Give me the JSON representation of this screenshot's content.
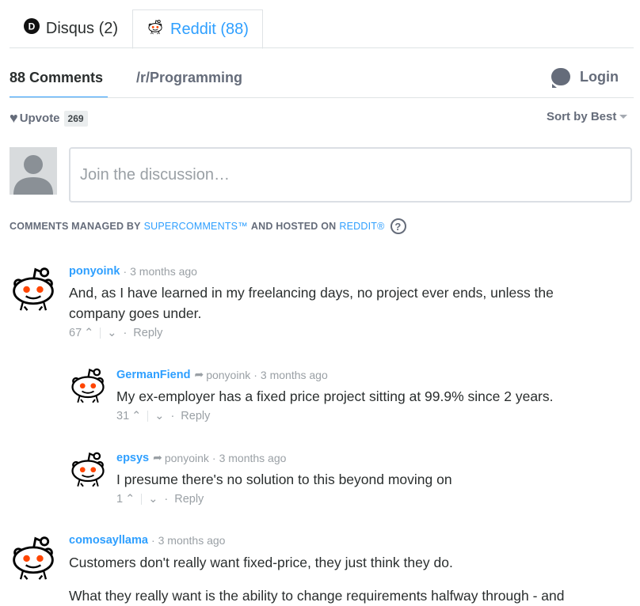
{
  "tabs": [
    {
      "label": "Disqus (2)",
      "icon": "disqus-logo-icon"
    },
    {
      "label": "Reddit (88)",
      "icon": "reddit-alien-icon",
      "active": true
    }
  ],
  "nav": {
    "comments_label": "88 Comments",
    "subreddit_label": "/r/Programming",
    "login_label": "Login"
  },
  "toolbar": {
    "upvote_label": "Upvote",
    "upvote_count": "269",
    "sort_label": "Sort by Best"
  },
  "composer": {
    "placeholder": "Join the discussion…"
  },
  "managed": {
    "prefix": "COMMENTS MANAGED BY",
    "supercomments": "SUPERCOMMENTS™",
    "middle": "AND HOSTED ON",
    "reddit": "REDDIT®",
    "help": "?"
  },
  "comments": [
    {
      "author": "ponyoink",
      "time": "3 months ago",
      "text_1": "And, as I have learned in my freelancing days, no project ever ends, unless the",
      "text_2": "company goes under.",
      "votes": "67",
      "reply": "Reply"
    },
    {
      "author": "GermanFiend",
      "parent": "ponyoink",
      "time": "3 months ago",
      "text_1": "My ex-employer has a fixed price project sitting at 99.9% since 2 years.",
      "votes": "31",
      "reply": "Reply"
    },
    {
      "author": "epsys",
      "parent": "ponyoink",
      "time": "3 months ago",
      "text_1": "I presume there's no solution to this beyond moving on",
      "votes": "1",
      "reply": "Reply"
    },
    {
      "author": "comosayllama",
      "time": "3 months ago",
      "text_1": "Customers don't really want fixed-price, they just think they do.",
      "text_2": "What they really want is the ability to change requirements halfway through - and"
    }
  ],
  "colors": {
    "accent": "#2e9fff",
    "text": "#2a2e2e",
    "muted": "#656c7a",
    "reddit_orange": "#ff4500"
  }
}
